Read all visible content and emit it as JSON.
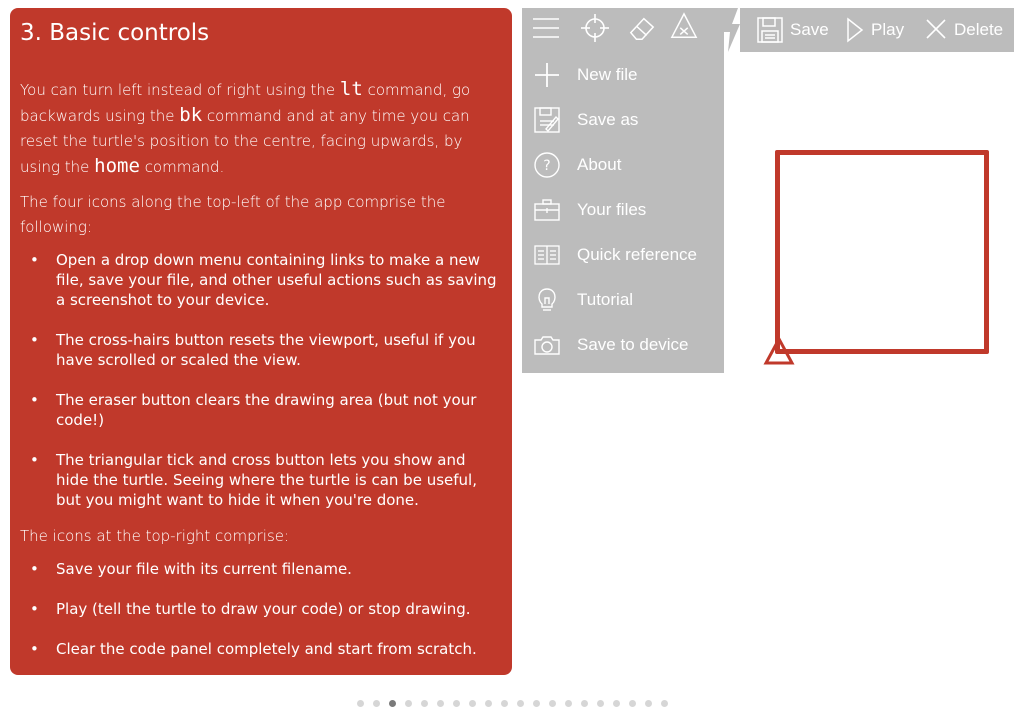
{
  "tutorial": {
    "title": "3. Basic controls",
    "intro": {
      "t1": "You can turn left instead of right using the ",
      "code1": "lt",
      "t2": " command, go backwards using the ",
      "code2": "bk",
      "t3": " command and at any time you can reset the turtle's position to the centre, facing upwards, by using the ",
      "code3": "home",
      "t4": " command."
    },
    "para2": "The four icons along the top-left of the app comprise the following:",
    "list1": [
      "Open a drop down menu containing links to make a new file, save your file, and other useful actions such as saving a screenshot to your device.",
      "The cross-hairs button resets the viewport, useful if you have scrolled or scaled the view.",
      "The eraser button clears the drawing area (but not your code!)",
      "The triangular tick and cross button lets you show and hide the turtle. Seeing where the turtle is can be useful, but you might want to hide it when you're done."
    ],
    "para3": "The icons at the top-right comprise:",
    "list2": [
      "Save your file with its current filename.",
      "Play (tell the turtle to draw your code) or stop drawing.",
      "Clear the code panel completely and start from scratch."
    ]
  },
  "toolbar": {
    "left_icons": [
      "menu-icon",
      "crosshair-icon",
      "eraser-icon",
      "turtle-toggle-icon"
    ],
    "save_label": "Save",
    "play_label": "Play",
    "delete_label": "Delete"
  },
  "menu": {
    "items": [
      {
        "label": "New file",
        "icon": "plus-icon"
      },
      {
        "label": "Save as",
        "icon": "save-as-icon"
      },
      {
        "label": "About",
        "icon": "question-icon"
      },
      {
        "label": "Your files",
        "icon": "briefcase-icon"
      },
      {
        "label": "Quick reference",
        "icon": "book-icon"
      },
      {
        "label": "Tutorial",
        "icon": "lightbulb-icon"
      },
      {
        "label": "Save to device",
        "icon": "camera-icon"
      }
    ]
  },
  "pager": {
    "total": 20,
    "current": 3
  },
  "colors": {
    "accent": "#c0392b",
    "toolbar": "#bcbcbc",
    "menu_text": "#ffffff"
  }
}
